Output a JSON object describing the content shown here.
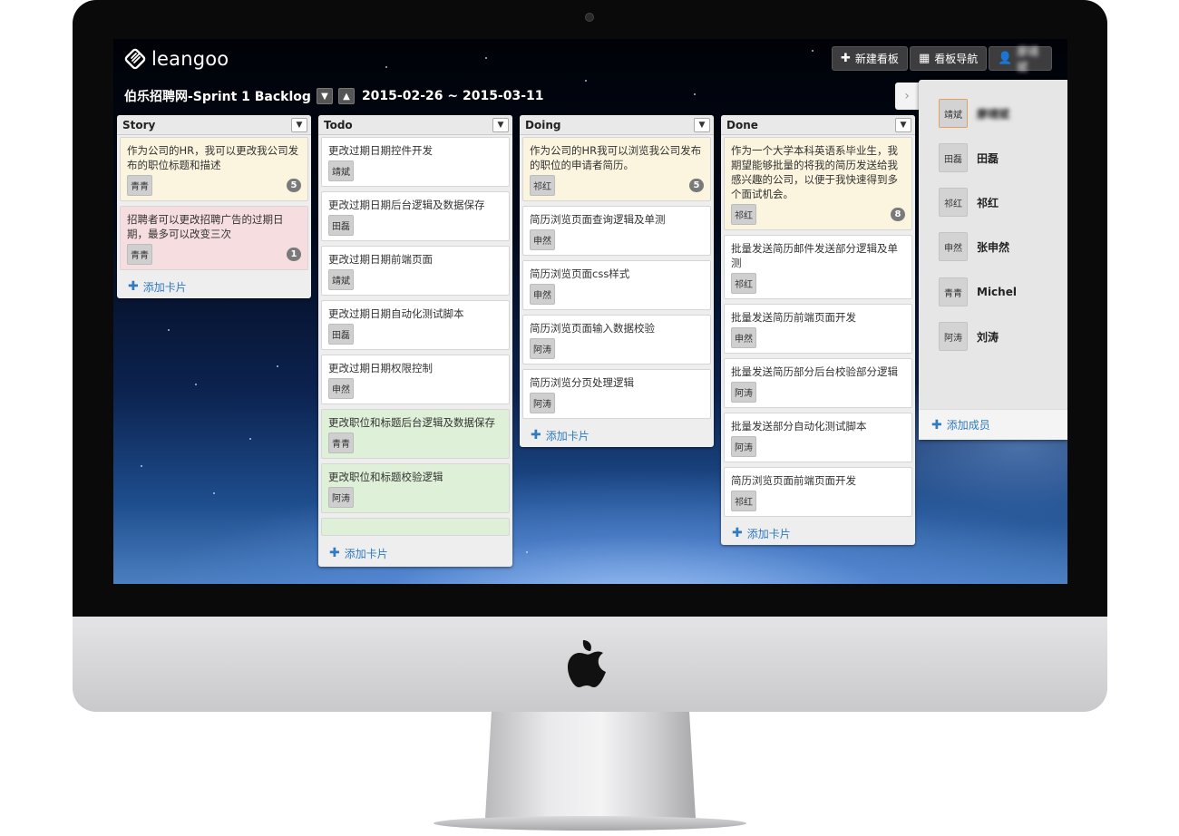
{
  "app": {
    "logo_text": "leangoo"
  },
  "header": {
    "new_board_label": "新建看板",
    "board_nav_label": "看板导航",
    "user_label": "廖靖斌"
  },
  "board": {
    "title": "伯乐招聘网-Sprint 1 Backlog",
    "dates": "2015-02-26 ~ 2015-03-11"
  },
  "columns": [
    {
      "title": "Story",
      "add_label": "添加卡片",
      "cards": [
        {
          "text": "作为公司的HR，我可以更改我公司发布的职位标题和描述",
          "tag": "青青",
          "badge": "5",
          "color": "yellow"
        },
        {
          "text": "招聘者可以更改招聘广告的过期日期，最多可以改变三次",
          "tag": "青青",
          "badge": "1",
          "color": "pink"
        }
      ]
    },
    {
      "title": "Todo",
      "add_label": "添加卡片",
      "cards": [
        {
          "text": "更改过期日期控件开发",
          "tag": "靖斌",
          "color": "white"
        },
        {
          "text": "更改过期日期后台逻辑及数据保存",
          "tag": "田磊",
          "color": "white"
        },
        {
          "text": "更改过期日期前端页面",
          "tag": "靖斌",
          "color": "white"
        },
        {
          "text": "更改过期日期自动化测试脚本",
          "tag": "田磊",
          "color": "white"
        },
        {
          "text": "更改过期日期权限控制",
          "tag": "申然",
          "color": "white"
        },
        {
          "text": "更改职位和标题后台逻辑及数据保存",
          "tag": "青青",
          "color": "green"
        },
        {
          "text": "更改职位和标题校验逻辑",
          "tag": "阿涛",
          "color": "green"
        }
      ]
    },
    {
      "title": "Doing",
      "add_label": "添加卡片",
      "cards": [
        {
          "text": "作为公司的HR我可以浏览我公司发布的职位的申请者简历。",
          "tag": "祁红",
          "badge": "5",
          "color": "yellow"
        },
        {
          "text": "简历浏览页面查询逻辑及单测",
          "tag": "申然",
          "color": "white"
        },
        {
          "text": "简历浏览页面css样式",
          "tag": "申然",
          "color": "white"
        },
        {
          "text": "简历浏览页面输入数据校验",
          "tag": "阿涛",
          "color": "white"
        },
        {
          "text": "简历浏览分页处理逻辑",
          "tag": "阿涛",
          "color": "white"
        }
      ]
    },
    {
      "title": "Done",
      "add_label": "添加卡片",
      "cards": [
        {
          "text": "作为一个大学本科英语系毕业生，我期望能够批量的将我的简历发送给我感兴趣的公司，以便于我快速得到多个面试机会。",
          "tag": "祁红",
          "badge": "8",
          "color": "yellow"
        },
        {
          "text": "批量发送简历邮件发送部分逻辑及单测",
          "tag": "祁红",
          "color": "white"
        },
        {
          "text": "批量发送简历前端页面开发",
          "tag": "申然",
          "color": "white"
        },
        {
          "text": "批量发送简历部分后台校验部分逻辑",
          "tag": "阿涛",
          "color": "white"
        },
        {
          "text": "批量发送部分自动化测试脚本",
          "tag": "阿涛",
          "color": "white"
        },
        {
          "text": "简历浏览页面前端页面开发",
          "tag": "祁红",
          "color": "white"
        }
      ]
    }
  ],
  "members": {
    "list": [
      {
        "avatar": "靖斌",
        "name": "廖靖斌"
      },
      {
        "avatar": "田磊",
        "name": "田磊"
      },
      {
        "avatar": "祁红",
        "name": "祁红"
      },
      {
        "avatar": "申然",
        "name": "张申然"
      },
      {
        "avatar": "青青",
        "name": "Michel"
      },
      {
        "avatar": "阿涛",
        "name": "刘涛"
      }
    ],
    "add_label": "添加成员"
  },
  "colors": {
    "link_blue": "#2f7bc0",
    "card_yellow": "#fbf4de",
    "card_pink": "#f6dde0",
    "card_green": "#dff0d8"
  }
}
